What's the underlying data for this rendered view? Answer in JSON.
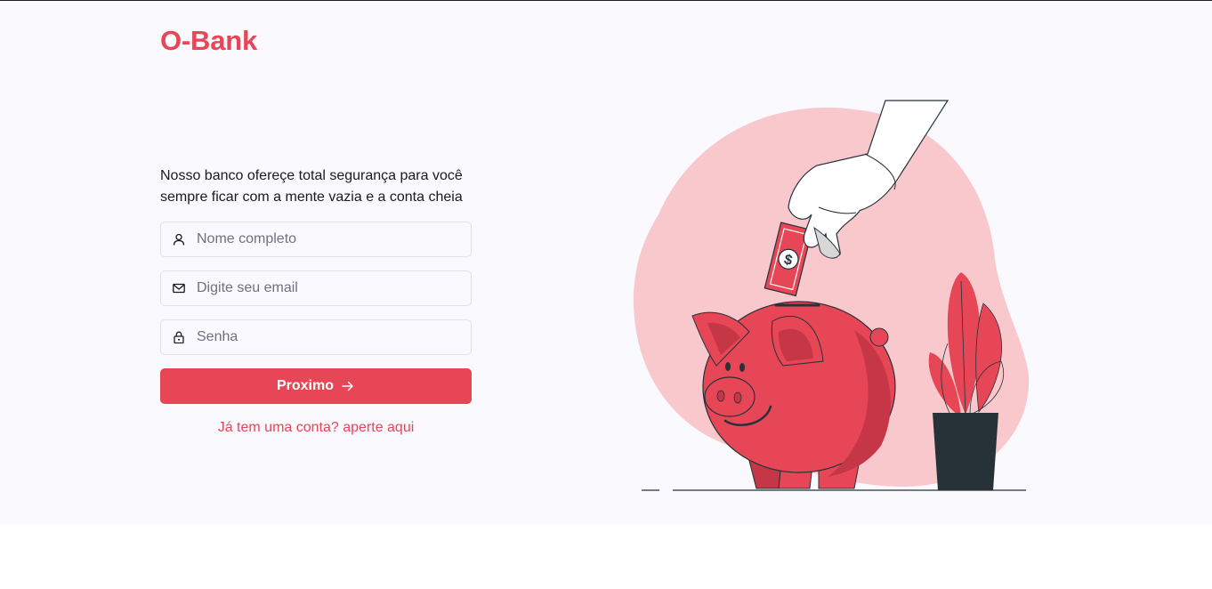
{
  "brand": {
    "name": "O-Bank"
  },
  "intro": {
    "text_line1": "Nosso banco ofereçe total segurança para você",
    "text_line2": "sempre ficar com a mente vazia e a conta cheia"
  },
  "form": {
    "name": {
      "placeholder": "Nome completo",
      "icon": "user-icon",
      "value": ""
    },
    "email": {
      "placeholder": "Digite seu email",
      "icon": "mail-icon",
      "value": ""
    },
    "password": {
      "placeholder": "Senha",
      "icon": "lock-icon",
      "value": ""
    },
    "submit_label": "Proximo",
    "submit_icon": "arrow-right-icon",
    "login_link": "Já tem uma conta? aperte aqui"
  },
  "colors": {
    "accent": "#e64656",
    "background": "#f9f9fe",
    "blob": "#f8c8cd",
    "pot": "#263238"
  }
}
